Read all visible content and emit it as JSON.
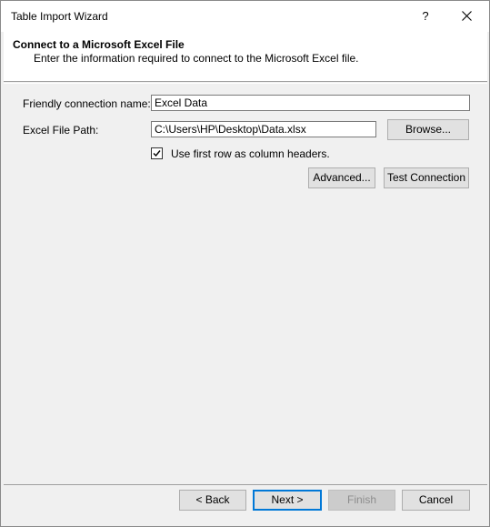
{
  "window": {
    "title": "Table Import Wizard",
    "help_glyph": "?"
  },
  "header": {
    "title": "Connect to a Microsoft Excel File",
    "subtitle": "Enter the information required to connect to the Microsoft Excel file."
  },
  "form": {
    "friendly_name_label": "Friendly connection name:",
    "friendly_name_value": "Excel Data",
    "file_path_label": "Excel File Path:",
    "file_path_value": "C:\\Users\\HP\\Desktop\\Data.xlsx",
    "browse_label": "Browse...",
    "first_row_headers_label": "Use first row as column headers.",
    "first_row_headers_checked": true,
    "advanced_label": "Advanced...",
    "test_connection_label": "Test Connection"
  },
  "footer": {
    "back_label": "< Back",
    "next_label": "Next >",
    "finish_label": "Finish",
    "cancel_label": "Cancel"
  }
}
